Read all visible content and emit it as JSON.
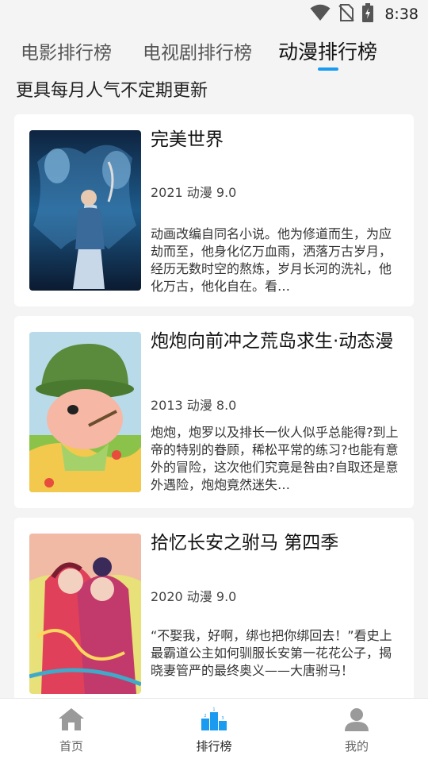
{
  "status_bar": {
    "time": "8:38"
  },
  "tabs": [
    {
      "label": "电影排行榜",
      "active": false
    },
    {
      "label": "电视剧排行榜",
      "active": false
    },
    {
      "label": "动漫排行榜",
      "active": true
    }
  ],
  "subtitle": "更具每月人气不定期更新",
  "items": [
    {
      "title": "完美世界",
      "meta": "2021 动漫 9.0",
      "desc": "动画改编自同名小说。他为修道而生，为应劫而至，他身化亿万血雨，洒落万古岁月，经历无数时空的熬炼，岁月长河的洗礼，他化万古，他化自在。看…"
    },
    {
      "title": "炮炮向前冲之荒岛求生·动态漫",
      "meta": "2013 动漫 8.0",
      "desc": "炮炮，炮罗以及排长一伙人似乎总能得?到上帝的特别的眷顾，稀松平常的练习?也能有意外的冒险，这次他们究竟是咎由?自取还是意外遇险，炮炮竟然迷失…"
    },
    {
      "title": "拾忆长安之驸马 第四季",
      "meta": "2020 动漫 9.0",
      "desc": "“不娶我，好啊，绑也把你绑回去！”看史上最霸道公主如何驯服长安第一花花公子，揭晓妻管严的最终奥义——大唐驸马！"
    }
  ],
  "bottom_nav": [
    {
      "label": "首页",
      "icon": "home-icon"
    },
    {
      "label": "排行榜",
      "icon": "ranking-icon"
    },
    {
      "label": "我的",
      "icon": "profile-icon"
    }
  ],
  "colors": {
    "accent": "#1a9bf0",
    "background": "#f4f4f4",
    "icon_gray": "#9a9a9a"
  }
}
